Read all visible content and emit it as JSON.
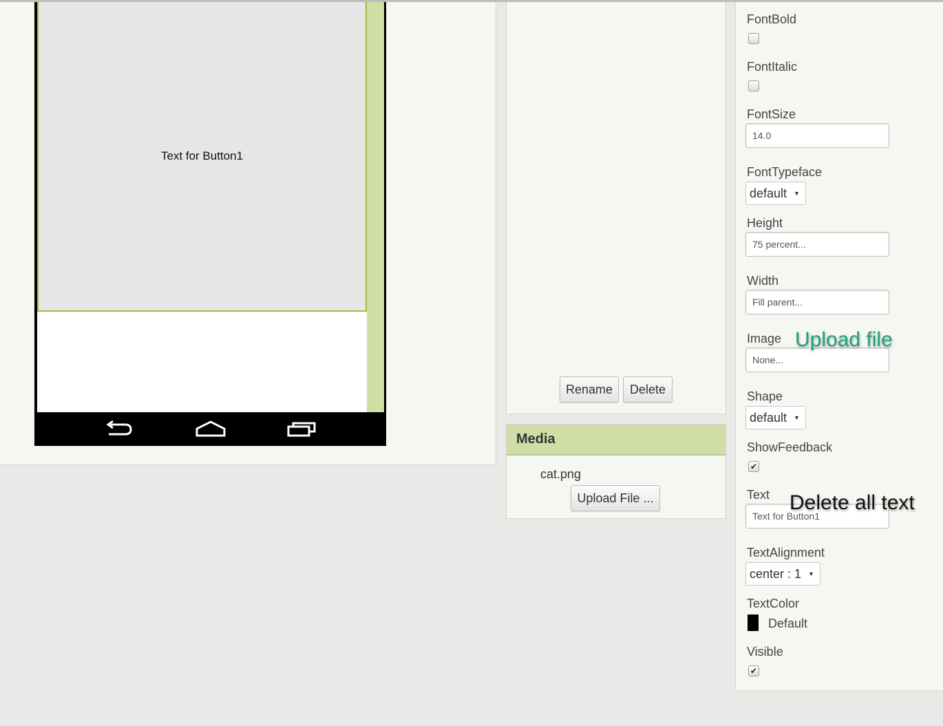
{
  "viewer": {
    "button_text": "Text for Button1"
  },
  "components": {
    "rename_label": "Rename",
    "delete_label": "Delete"
  },
  "media": {
    "title": "Media",
    "files": [
      "cat.png"
    ],
    "upload_label": "Upload File ..."
  },
  "properties": {
    "font_bold": {
      "label": "FontBold",
      "checked": false
    },
    "font_italic": {
      "label": "FontItalic",
      "checked": false
    },
    "font_size": {
      "label": "FontSize",
      "value": "14.0"
    },
    "font_typeface": {
      "label": "FontTypeface",
      "value": "default"
    },
    "height": {
      "label": "Height",
      "value": "75 percent..."
    },
    "width": {
      "label": "Width",
      "value": "Fill parent..."
    },
    "image": {
      "label": "Image",
      "value": "None..."
    },
    "shape": {
      "label": "Shape",
      "value": "default"
    },
    "show_feedback": {
      "label": "ShowFeedback",
      "checked": true,
      "mark": "✔"
    },
    "text": {
      "label": "Text",
      "value": "Text for Button1"
    },
    "text_alignment": {
      "label": "TextAlignment",
      "value": "center : 1"
    },
    "text_color": {
      "label": "TextColor",
      "value": "Default",
      "swatch": "#000000"
    },
    "visible": {
      "label": "Visible",
      "checked": true,
      "mark": "✔"
    }
  },
  "annotations": {
    "upload_file": "Upload file",
    "delete_all_text": "Delete all text"
  },
  "colors": {
    "accent_green": "#cfdea7",
    "selection_green": "#9bbf38",
    "annotation_green": "#1fa07f"
  }
}
